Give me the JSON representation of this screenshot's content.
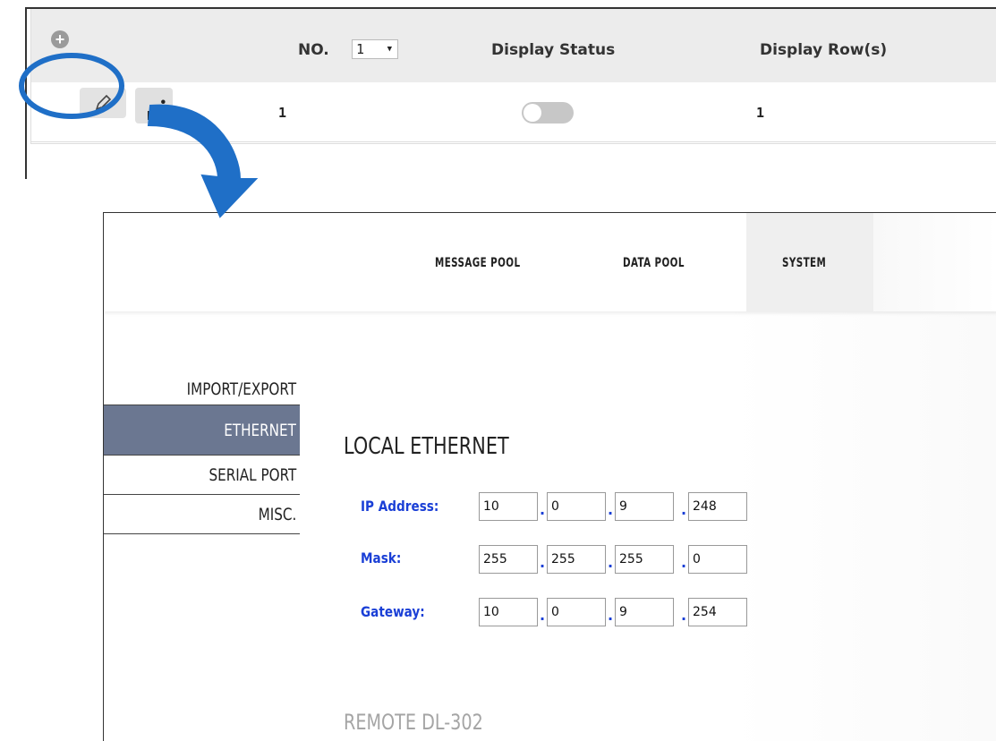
{
  "top_table": {
    "no_label": "NO.",
    "no_value": "1",
    "col_display_status": "Display Status",
    "col_display_rows": "Display Row(s)",
    "row_no": "1",
    "row_display_rows": "1",
    "toggle_on": false
  },
  "nav": {
    "items": [
      "MESSAGE POOL",
      "DATA POOL",
      "SYSTEM"
    ],
    "active": "SYSTEM"
  },
  "sidebar": {
    "items": [
      {
        "label": "IMPORT/EXPORT"
      },
      {
        "label": "ETHERNET"
      },
      {
        "label": "SERIAL PORT"
      },
      {
        "label": "MISC."
      }
    ],
    "active": "ETHERNET"
  },
  "local_ethernet": {
    "title": "LOCAL ETHERNET",
    "ip_label": "IP Address:",
    "ip": [
      "10",
      "0",
      "9",
      "248"
    ],
    "mask_label": "Mask:",
    "mask": [
      "255",
      "255",
      "255",
      "0"
    ],
    "gateway_label": "Gateway:",
    "gateway": [
      "10",
      "0",
      "9",
      "254"
    ]
  },
  "remote_title": "REMOTE DL-302",
  "colors": {
    "sidebar_active": "#6b7791",
    "label_blue": "#1a3fd6",
    "highlight_blue": "#1f6fc7"
  }
}
